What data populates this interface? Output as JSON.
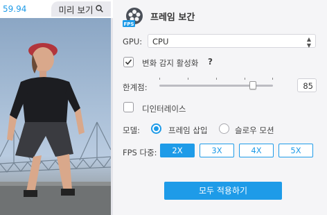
{
  "preview": {
    "fps": "59.94",
    "button_label": "미리 보기",
    "button_icon": "magnifier-icon"
  },
  "panel": {
    "title": "프레임 보간",
    "title_icon": "film-reel-fps-icon",
    "gpu": {
      "label": "GPU:",
      "value": "CPU"
    },
    "scene_detect": {
      "label": "변화 감지 활성화",
      "help": "?",
      "checked": true
    },
    "threshold": {
      "label": "한계점:",
      "value": "85",
      "level_percent": 85
    },
    "deinterlace": {
      "label": "디인터레이스",
      "checked": false
    },
    "mode": {
      "label": "모델:",
      "options": [
        "프레임 삽입",
        "슬로우 모션"
      ],
      "selected": "프레임 삽입"
    },
    "fps_multiplier": {
      "label": "FPS 다중:",
      "options": [
        "2X",
        "3X",
        "4X",
        "5X"
      ],
      "selected": "2X"
    },
    "apply_all": "모두 적용하기"
  },
  "colors": {
    "accent": "#1e9be8",
    "panel_bg": "#f5f5f7"
  }
}
